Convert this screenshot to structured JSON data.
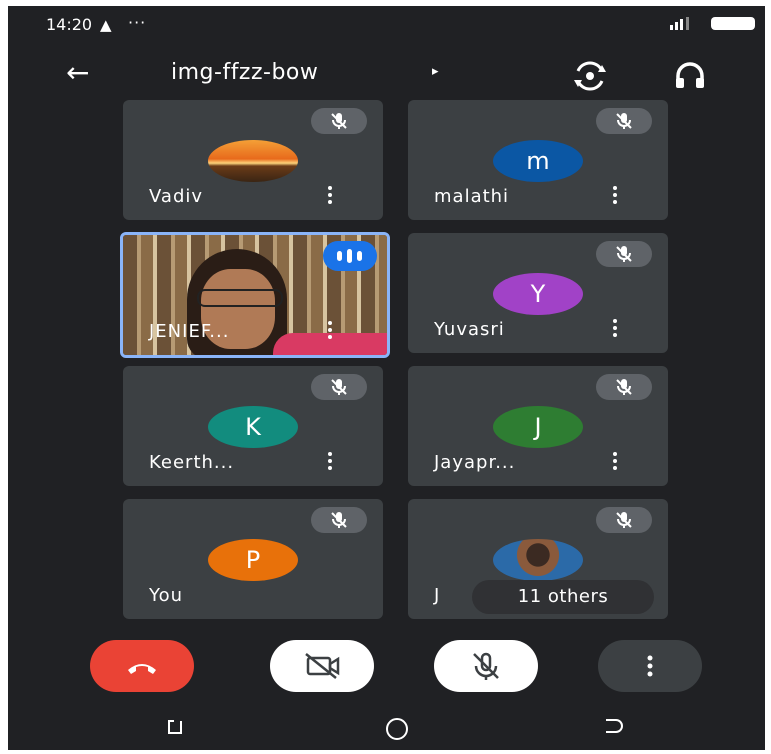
{
  "status_bar": {
    "time": "14:20",
    "warning": "▲",
    "dots": "···"
  },
  "header": {
    "back": "←",
    "meeting_code": "img-ffzz-bow",
    "caret": "▸"
  },
  "participants": [
    {
      "name": "Vadiv",
      "avatar": "photo-sunset",
      "muted": true
    },
    {
      "name": "malathi",
      "initial": "m",
      "color": "#0b57a4",
      "muted": true
    },
    {
      "name": "JENIEF...",
      "avatar": "video",
      "speaking": true
    },
    {
      "name": "Yuvasri",
      "initial": "Y",
      "color": "#a142c7",
      "muted": true
    },
    {
      "name": "Keerth...",
      "initial": "K",
      "color": "#128c7e",
      "muted": true
    },
    {
      "name": "Jayapr...",
      "initial": "J",
      "color": "#2e7d32",
      "muted": true
    },
    {
      "name": "You",
      "initial": "P",
      "color": "#e8710a",
      "muted": true
    },
    {
      "name": "J",
      "avatar": "photo-person",
      "muted": true,
      "others_label": "11 others"
    }
  ],
  "controls": {
    "end_call_color": "#ea4335",
    "camera_button_color": "#ffffff",
    "mic_button_color": "#ffffff",
    "more_button_color": "#3c4043"
  }
}
